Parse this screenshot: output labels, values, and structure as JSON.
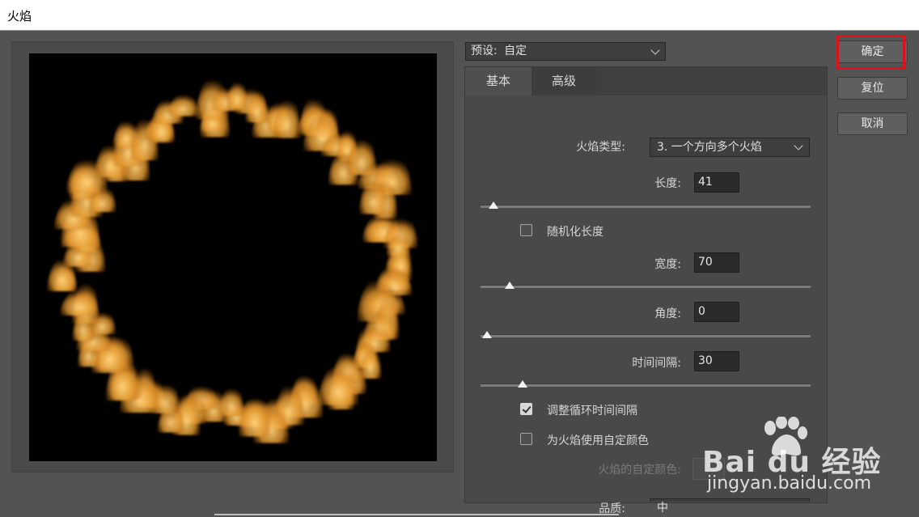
{
  "window": {
    "title": "火焰"
  },
  "preset": {
    "label": "预设:",
    "value": "自定"
  },
  "tabs": [
    {
      "label": "基本",
      "active": true
    },
    {
      "label": "高级",
      "active": false
    }
  ],
  "basic": {
    "flame_type": {
      "label": "火焰类型:",
      "value": "3. 一个方向多个火焰"
    },
    "length": {
      "label": "长度:",
      "value": "41",
      "slider_fraction": 0.02
    },
    "randomize_length": {
      "label": "随机化长度",
      "checked": false
    },
    "width": {
      "label": "宽度:",
      "value": "70",
      "slider_fraction": 0.07
    },
    "angle": {
      "label": "角度:",
      "value": "0",
      "slider_fraction": 0.0
    },
    "interval": {
      "label": "时间间隔:",
      "value": "30",
      "slider_fraction": 0.11
    },
    "adjust_loop": {
      "label": "调整循环时间间隔",
      "checked": true
    },
    "use_custom_color": {
      "label": "为火焰使用自定颜色",
      "checked": false
    },
    "custom_color": {
      "label": "火焰的自定颜色:"
    },
    "quality": {
      "label": "品质:",
      "value": "中"
    }
  },
  "buttons": {
    "ok": "确定",
    "reset": "复位",
    "cancel": "取消"
  },
  "watermark": {
    "logo": "Bai du 经验",
    "url": "jingyan.baidu.com"
  },
  "colors": {
    "accent_highlight": "#e0101a",
    "flame_core": "#ffd27a",
    "flame_edge": "#b06010",
    "dialog_bg": "#535353"
  },
  "icons": {
    "preset_dropdown": "chevron-down-icon",
    "checkbox_checked": "check-icon",
    "watermark_paw": "paw-icon"
  }
}
